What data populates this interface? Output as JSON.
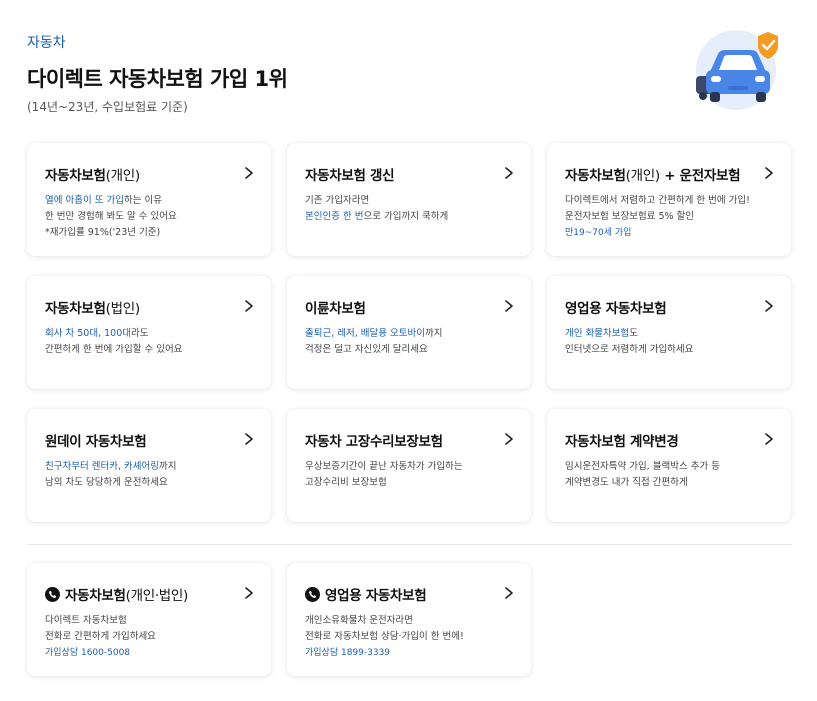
{
  "header": {
    "category": "자동차",
    "headline": "다이렉트 자동차보험 가입 1위",
    "subline": "(14년~23년, 수입보험료 기준)"
  },
  "cards": [
    {
      "title": "자동차보험",
      "title_paren": "(개인)",
      "lines": [
        [
          {
            "t": "열에 아홉이 또 가입",
            "hl": true
          },
          {
            "t": "하는 이유"
          }
        ],
        [
          {
            "t": "한 번만 경험해 봐도 알 수 있어요"
          }
        ],
        [
          {
            "t": "*재가입률 91%('23년 기준)"
          }
        ]
      ]
    },
    {
      "title": "자동차보험 갱신",
      "title_paren": "",
      "lines": [
        [
          {
            "t": "기존 가입자라면"
          }
        ],
        [
          {
            "t": "본인인증 한 번",
            "hl": true
          },
          {
            "t": "으로 가입까지 쿡하게"
          }
        ]
      ]
    },
    {
      "title": "자동차보험",
      "title_paren": "(개인)",
      "title_suffix": " + 운전자보험",
      "lines": [
        [
          {
            "t": "다이렉트에서 저렴하고 간편하게 한 번에 가입!"
          }
        ],
        [
          {
            "t": "운전자보험 보장보험료 5% 할인"
          }
        ],
        [
          {
            "t": "만19~70세 가입",
            "tag": true
          }
        ]
      ]
    },
    {
      "title": "자동차보험",
      "title_paren": "(법인)",
      "lines": [
        [
          {
            "t": "회사 차 50대, 100대",
            "hl": true
          },
          {
            "t": "라도"
          }
        ],
        [
          {
            "t": "간편하게 한 번에 가입할 수 있어요"
          }
        ]
      ]
    },
    {
      "title": "이륜차보험",
      "title_paren": "",
      "lines": [
        [
          {
            "t": "출퇴근, 레저, 배달용 오토바이",
            "hl": true
          },
          {
            "t": "까지"
          }
        ],
        [
          {
            "t": "걱정은 덜고 자신있게 달리세요"
          }
        ]
      ]
    },
    {
      "title": "영업용 자동차보험",
      "title_paren": "",
      "lines": [
        [
          {
            "t": "개인 화물차보험",
            "hl": true
          },
          {
            "t": "도"
          }
        ],
        [
          {
            "t": "인터넷으로 저렴하게 가입하세요"
          }
        ]
      ]
    },
    {
      "title": "원데이 자동차보험",
      "title_paren": "",
      "lines": [
        [
          {
            "t": "친구차부터 렌터카, 카셰어링",
            "hl": true
          },
          {
            "t": "까지"
          }
        ],
        [
          {
            "t": "남의 차도 당당하게 운전하세요"
          }
        ]
      ]
    },
    {
      "title": "자동차 고장수리보장보험",
      "title_paren": "",
      "lines": [
        [
          {
            "t": "우상보증기간이 끝난 자동차가 가입하는"
          }
        ],
        [
          {
            "t": "고장수리비 보장보험"
          }
        ]
      ]
    },
    {
      "title": "자동차보험 계약변경",
      "title_paren": "",
      "lines": [
        [
          {
            "t": "임시운전자특약 가입, 블랙박스 추가 등"
          }
        ],
        [
          {
            "t": "계약변경도 내가 직접 간편하게"
          }
        ]
      ]
    }
  ],
  "phone_cards": [
    {
      "title": "자동차보험",
      "title_paren": "(개인·법인)",
      "icon": "phone-icon",
      "lines": [
        [
          {
            "t": "다이렉트 자동차보험"
          }
        ],
        [
          {
            "t": "전화로 간편하게 가입하세요"
          }
        ],
        [
          {
            "t": "가입상담 1600-5008",
            "tag": true
          }
        ]
      ]
    },
    {
      "title": "영업용 자동차보험",
      "title_paren": "",
      "icon": "phone-icon",
      "lines": [
        [
          {
            "t": "개인소유화물차 운전자라면"
          }
        ],
        [
          {
            "t": "전화로 자동차보험 상담·가입이 한 번에!"
          }
        ],
        [
          {
            "t": "가입상담 1899-3339",
            "tag": true
          }
        ]
      ]
    }
  ],
  "colors": {
    "accent_blue": "#1a5fb4",
    "car_blue": "#4a86e8",
    "shield_orange": "#f59a23",
    "hero_bg": "#e6eefb"
  },
  "icons": {
    "hero": "car-shield-icon",
    "chevron": "chevron-right-icon"
  }
}
